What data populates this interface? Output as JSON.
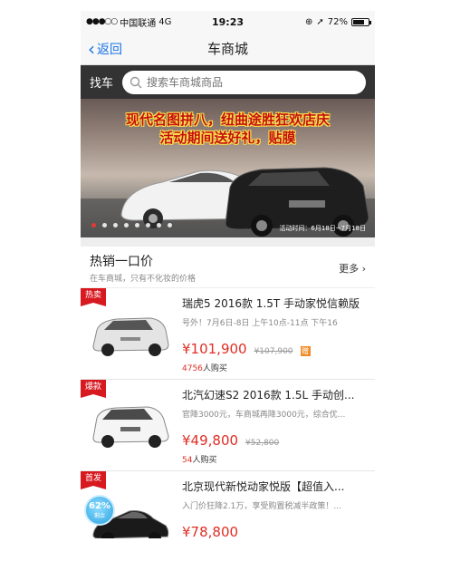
{
  "status_bar": {
    "carrier": "中国联通",
    "network": "4G",
    "time": "19:23",
    "battery": "72%",
    "battery_level": 0.72
  },
  "nav": {
    "back_label": "返回",
    "title": "车商城"
  },
  "search": {
    "label": "找车",
    "placeholder": "搜索车商城商品"
  },
  "banner": {
    "headline_line1": "现代名图拼八，纽曲途胜狂欢店庆",
    "headline_line2": "活动期间送好礼，贴膜",
    "date_text": "活动时间：6月18日~7月18日",
    "slide_count": 8,
    "active_slide": 0
  },
  "section": {
    "title": "热销一口价",
    "subtitle": "在车商城，只有不化妆的价格",
    "more_label": "更多"
  },
  "products": [
    {
      "badge": "热卖",
      "title": "瑞虎5 2016款 1.5T 手动家悦信赖版",
      "desc": "号外！7月6日-8日 上午10点-11点 下午16",
      "price": "¥101,900",
      "original_price": "¥107,900",
      "gift": "赠",
      "buy_count_num": "4756",
      "buy_count_suffix": "人购买",
      "car_color": "#e8e8e8"
    },
    {
      "badge": "爆款",
      "title": "北汽幻速S2 2016款 1.5L 手动创...",
      "desc": "官降3000元，车商城再降3000元，综合优...",
      "price": "¥49,800",
      "original_price": "¥52,800",
      "buy_count_num": "54",
      "buy_count_suffix": "人购买",
      "car_color": "#f4f4f4"
    },
    {
      "badge": "首发",
      "title": "北京现代新悦动家悦版【超值入...",
      "desc": "入门价狂降2.1万，享受购置税减半政策！...",
      "price": "¥78,800",
      "progress_label": "62%",
      "progress_value": 0.62,
      "progress_caption": "剩余",
      "car_color": "#1a1a1a"
    }
  ]
}
